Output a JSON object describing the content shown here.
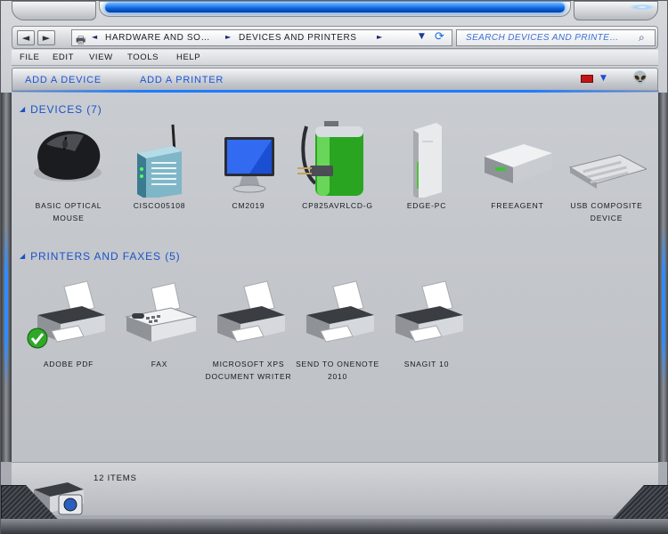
{
  "window": {
    "nav": {
      "back": "◄",
      "forward": "►"
    },
    "address": {
      "crumb1": "HARDWARE AND SO…",
      "crumb2": "DEVICES AND PRINTERS",
      "dropdown": "▼",
      "refresh": "⟳"
    },
    "search": {
      "placeholder": "SEARCH DEVICES AND PRINTE…",
      "icon": "search-icon"
    }
  },
  "menu": {
    "file": "FILE",
    "edit": "EDIT",
    "view": "VIEW",
    "tools": "TOOLS",
    "help": "HELP"
  },
  "commands": {
    "add_device": "ADD A DEVICE",
    "add_printer": "ADD A PRINTER",
    "accent_color": "#1c56d6"
  },
  "devices": {
    "header": "DEVICES (7)",
    "items": [
      {
        "label": "BASIC OPTICAL MOUSE",
        "icon": "mouse-icon"
      },
      {
        "label": "CISCO05108",
        "icon": "router-icon"
      },
      {
        "label": "CM2019",
        "icon": "monitor-icon"
      },
      {
        "label": "CP825AVRLCD-G",
        "icon": "battery-icon"
      },
      {
        "label": "EDGE-PC",
        "icon": "pc-tower-icon"
      },
      {
        "label": "FREEAGENT",
        "icon": "external-drive-icon"
      },
      {
        "label": "USB COMPOSITE DEVICE",
        "icon": "keyboard-icon"
      }
    ]
  },
  "printers": {
    "header": "PRINTERS AND FAXES (5)",
    "items": [
      {
        "label": "ADOBE PDF",
        "icon": "printer-icon",
        "default": true
      },
      {
        "label": "FAX",
        "icon": "fax-icon"
      },
      {
        "label": "MICROSOFT XPS DOCUMENT WRITER",
        "icon": "printer-icon"
      },
      {
        "label": "SEND TO ONENOTE 2010",
        "icon": "printer-icon"
      },
      {
        "label": "SNAGIT 10",
        "icon": "printer-icon"
      }
    ]
  },
  "status": {
    "count": "12 ITEMS"
  }
}
